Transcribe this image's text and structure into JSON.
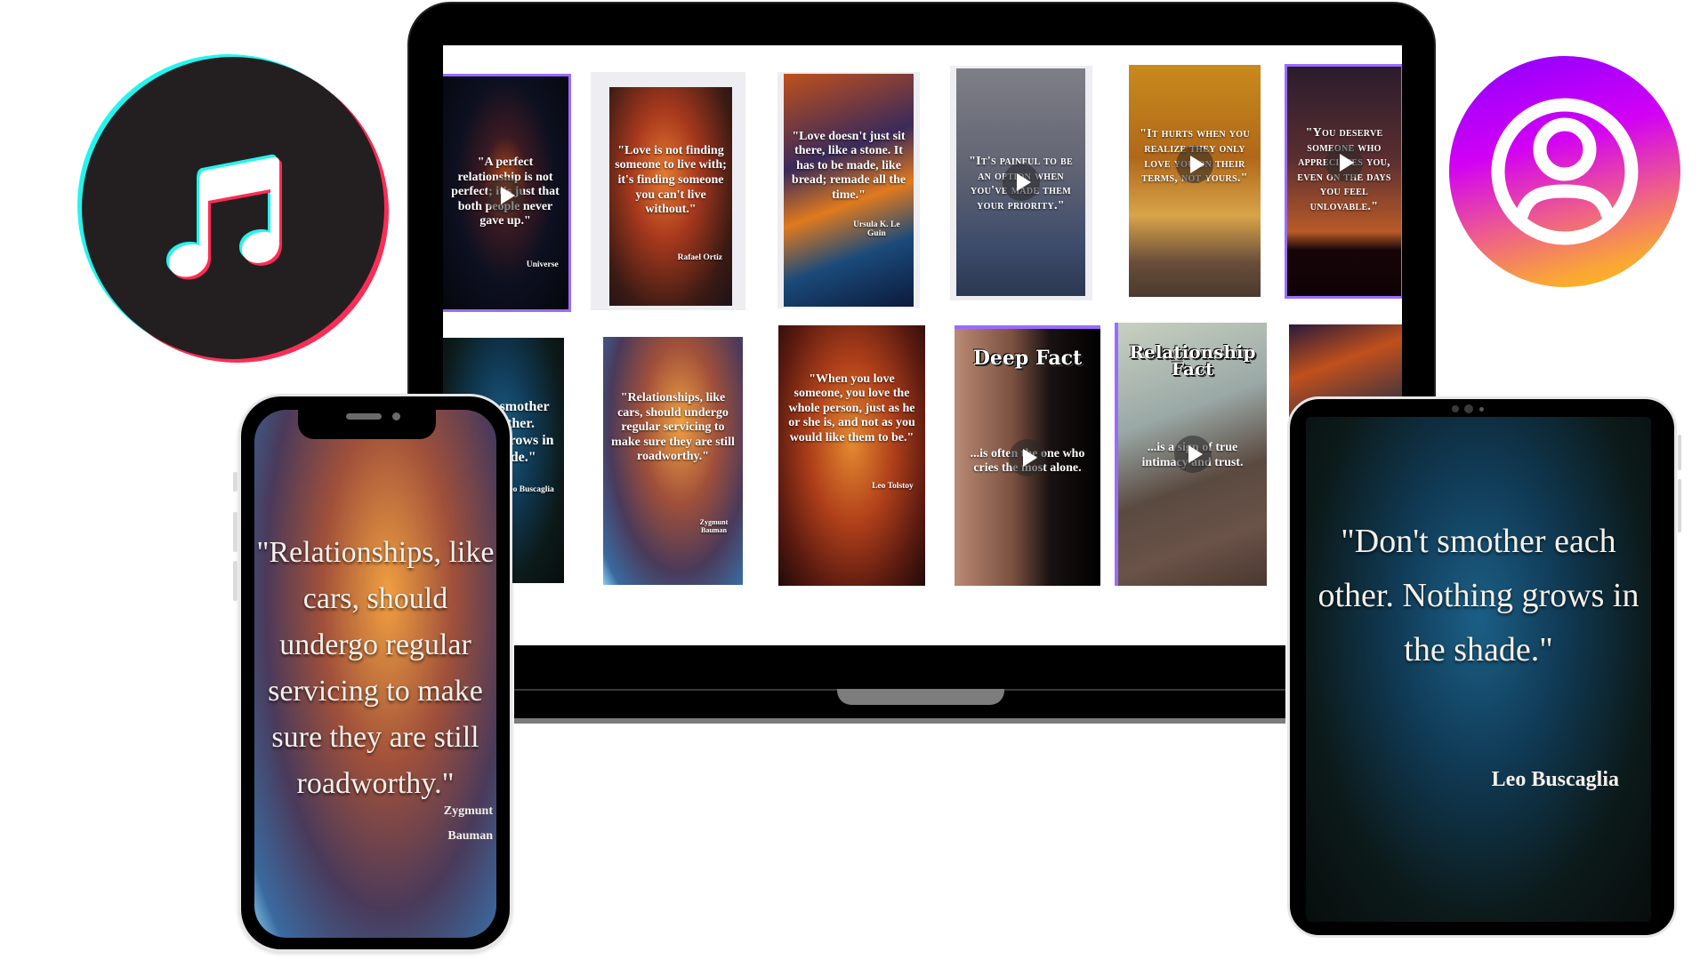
{
  "icons": {
    "left": {
      "name": "tiktok-music-note",
      "colors": {
        "bg": "#231f20",
        "cyan": "#25f4ee",
        "pink": "#fe2c55"
      }
    },
    "right": {
      "name": "instagram-profile",
      "colors": {
        "gradient": [
          "#8a00ff",
          "#d200f5",
          "#ee5f8a",
          "#ffc60a"
        ]
      }
    }
  },
  "laptop": {
    "row1": [
      {
        "quote": "\"A perfect relationship is not perfect; it's just that both people never gave up.\"",
        "author": "Universe",
        "style": "serif",
        "play": true
      },
      {
        "quote": "\"Love is not finding someone to live with; it's finding someone you can't live without.\"",
        "author": "Rafael Ortiz",
        "style": "serif",
        "play": false
      },
      {
        "quote": "\"Love doesn't just sit there, like a stone. It has to be made, like bread; remade all the time.\"",
        "author": "Ursula K. Le Guin",
        "style": "serif",
        "play": false
      },
      {
        "quote": "\"It's painful to be an option when you've made them your priority.\"",
        "author": "",
        "style": "caps",
        "play": true
      },
      {
        "quote": "\"It hurts when you realize they only love you on their terms, not yours.\"",
        "author": "",
        "style": "caps",
        "play": true
      },
      {
        "quote": "\"You deserve someone who appreciates you, even on the days you feel unlovable.\"",
        "author": "",
        "style": "caps",
        "play": true
      }
    ],
    "row2": [
      {
        "quote": "\"Don't smother each other. Nothing grows in the shade.\"",
        "author": "Leo Buscaglia",
        "style": "serif",
        "play": false
      },
      {
        "quote": "\"Relationships, like cars, should undergo regular servicing to make sure they are still roadworthy.\"",
        "author": "Zygmunt Bauman",
        "style": "serif",
        "play": false
      },
      {
        "quote": "\"When you love someone, you love the whole person, just as he or she is, and not as you would like them to be.\"",
        "author": "Leo Tolstoy",
        "style": "serif",
        "play": false
      },
      {
        "heading": "Deep Fact",
        "quote": "...is often the one who cries the most alone.",
        "author": "",
        "style": "fact",
        "play": true
      },
      {
        "heading": "Relationship Fact",
        "quote": "...is a sign of true intimacy and trust.",
        "author": "",
        "style": "fact",
        "play": true
      },
      {
        "quote": "",
        "author": "",
        "style": "serif",
        "play": false
      }
    ]
  },
  "phone": {
    "quote": "\"Relationships, like cars, should undergo regular servicing to make sure they are still roadworthy.\"",
    "author": "Zygmunt Bauman"
  },
  "tablet": {
    "quote": "\"Don't smother each other. Nothing grows in the shade.\"",
    "author": "Leo Buscaglia"
  }
}
